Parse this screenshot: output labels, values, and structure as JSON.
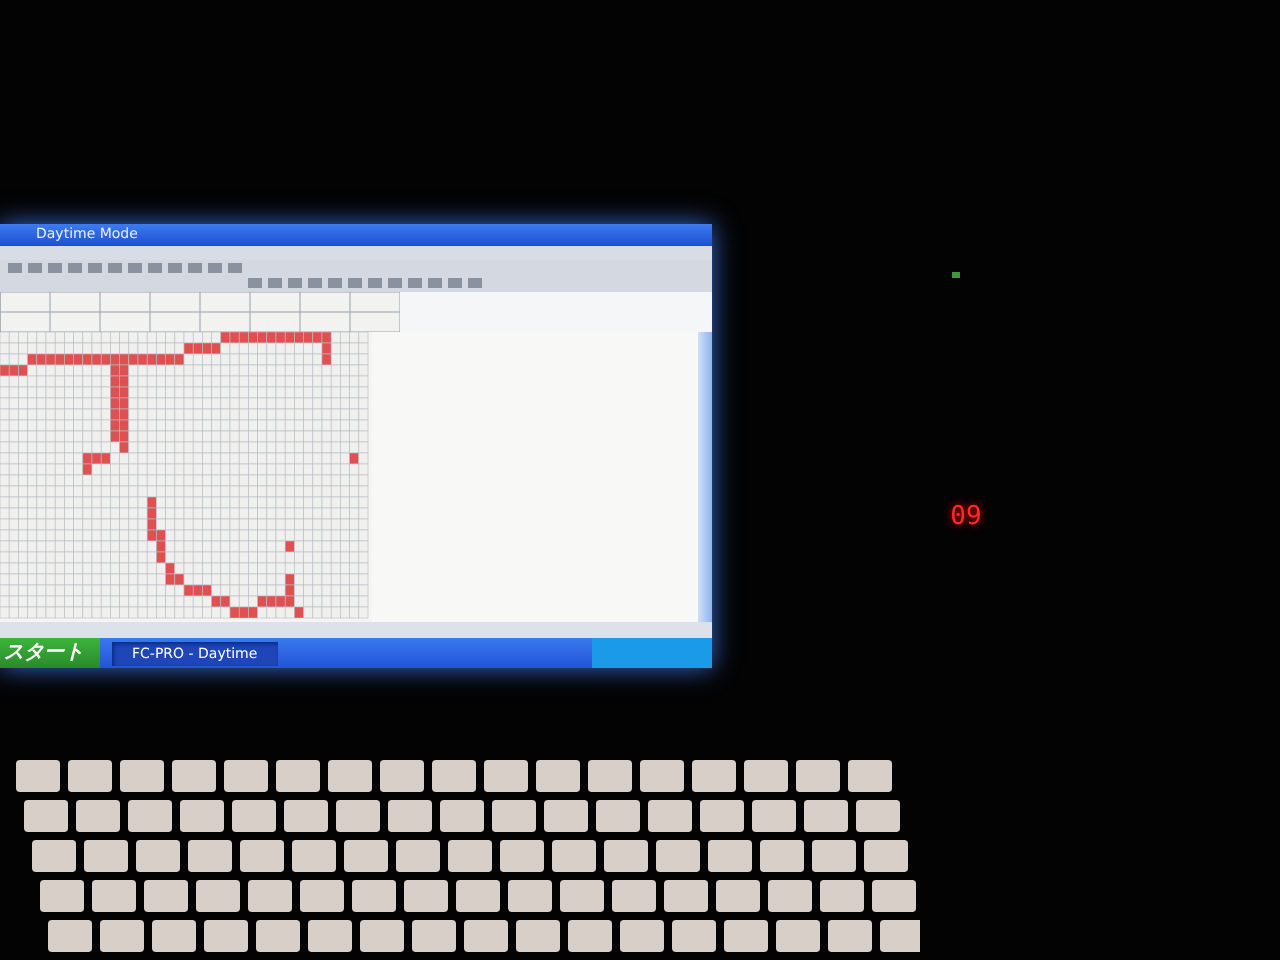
{
  "window": {
    "title": "Daytime Mode"
  },
  "taskbar": {
    "start_button": "スタート",
    "tasks": [
      {
        "label": "FC-PRO - Daytime",
        "selected": true
      }
    ]
  },
  "led_clock": {
    "reading": "09"
  }
}
